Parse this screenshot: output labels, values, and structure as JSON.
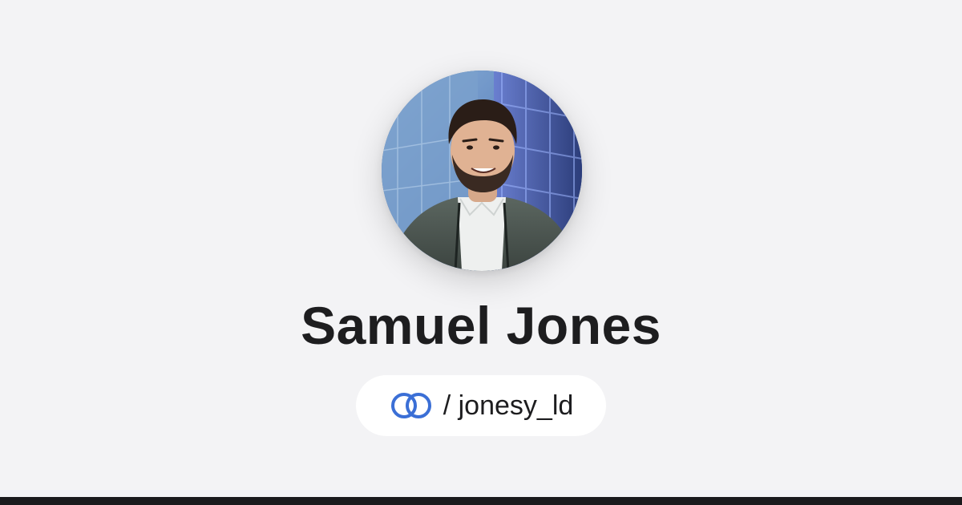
{
  "profile": {
    "name": "Samuel Jones",
    "handle_prefix": "/",
    "handle": "jonesy_ld",
    "avatar_icon": "profile-photo",
    "link_icon": "linktree-rings-icon"
  },
  "colors": {
    "background": "#f3f3f5",
    "pill_background": "#ffffff",
    "text": "#1d1d1f",
    "link_icon": "#3b6fd6",
    "bottom_bar": "#1a1a1c"
  }
}
